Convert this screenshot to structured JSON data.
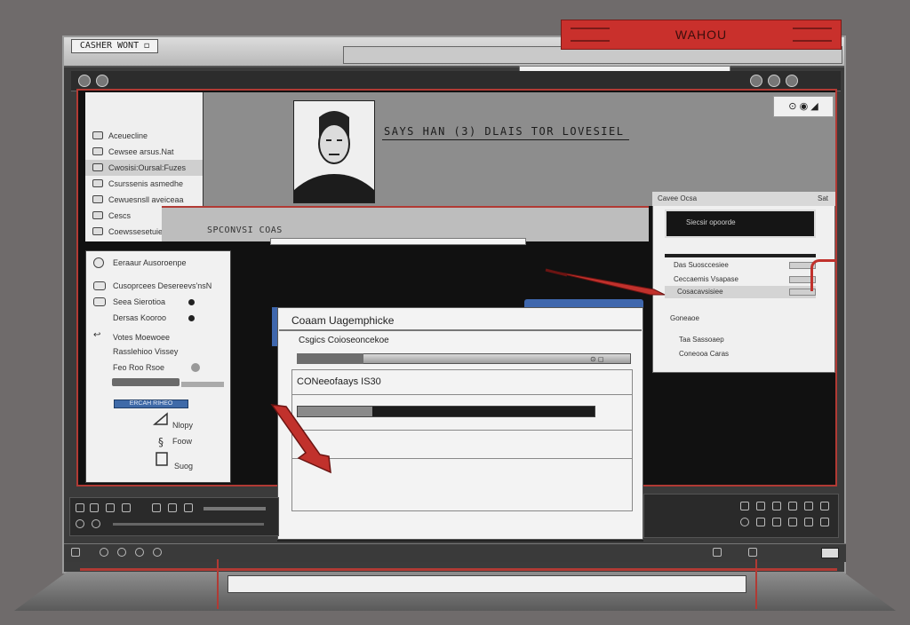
{
  "window": {
    "title_label": "CASHER WONT ◻"
  },
  "badge": {
    "text": "WAHOU"
  },
  "header": {
    "profile_name": "SAYS HAN (3) DLAIS TOR LOVESIEL",
    "icons_text": "⊙ ◉ ◢"
  },
  "sidebar_top": {
    "items": [
      {
        "label": "Aceuecline"
      },
      {
        "label": "Cewsee arsus.Nat"
      },
      {
        "label": "Cwosisi:Oursal:Fuzes"
      },
      {
        "label": "Csurssenis asmedhe"
      },
      {
        "label": "Cewuesnsll aveiceaa"
      },
      {
        "label": "Cescs"
      },
      {
        "label": "Coewssesetuie nurses"
      }
    ]
  },
  "banner": {
    "label": "SPCONVSI COAS"
  },
  "left_panel": {
    "items": [
      {
        "label": "Eeraaur Ausoroenpe"
      },
      {
        "label": "Cusoprcees Desereevs'nsN"
      },
      {
        "label": "Seea Sierotioa"
      },
      {
        "label": "Dersas Kooroo"
      },
      {
        "label": "Votes Moewoee"
      },
      {
        "label": "Rasslehioo Vissey"
      },
      {
        "label": "Feo Roo Rsoe"
      }
    ],
    "blue_button": "ERCAH RIHEO",
    "small_labels": [
      "Nlopy",
      "Foow",
      "Suog"
    ]
  },
  "right_panel": {
    "head_left": "Cavee Ocsa",
    "head_right": "Sat",
    "black_label": "Siecsir opoorde",
    "rows": [
      {
        "label": "Das Suosccesiee"
      },
      {
        "label": "Ceccaemis Vsapase"
      },
      {
        "label": "Cosacavsisiee"
      },
      {
        "label": "Goneaoe"
      },
      {
        "label": "Taa Sassoaep"
      },
      {
        "label": "Coneooa Caras"
      }
    ]
  },
  "dialog": {
    "title": "Coaam Uagemphicke",
    "subtitle": "Csgics Coioseoncekoe",
    "progress_percent": 20,
    "progress_end": "⊙ ◻",
    "field_label": "CONeeofaays IS30",
    "field_progress_percent": 25
  },
  "colors": {
    "accent_red": "#c9302c",
    "accent_blue": "#3f67ad",
    "frame_dark": "#3b3b3b"
  }
}
